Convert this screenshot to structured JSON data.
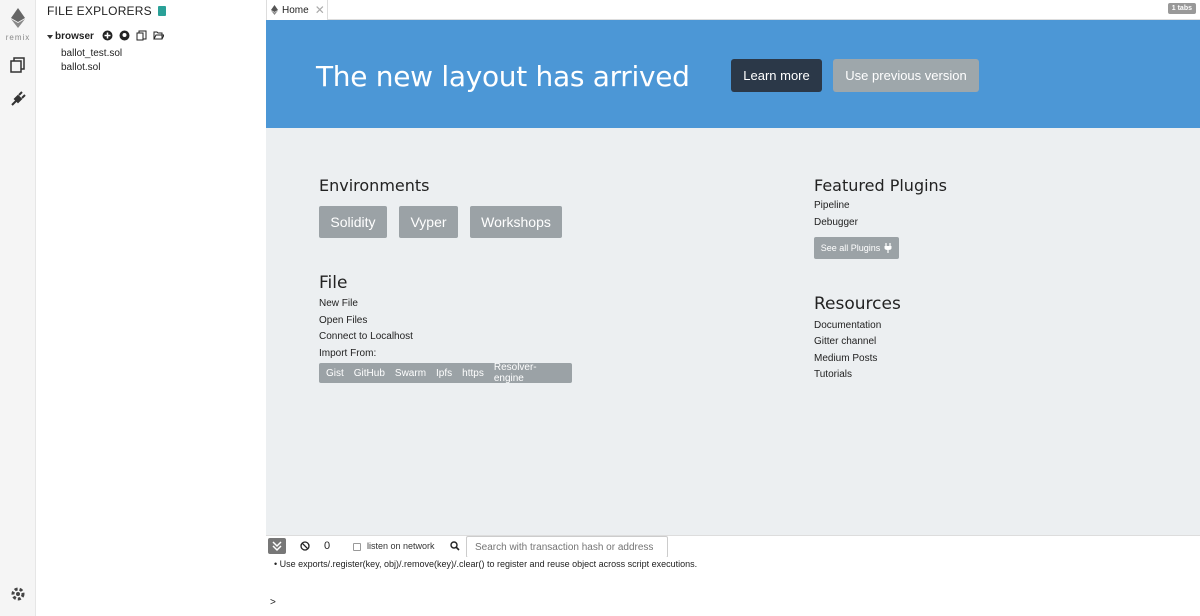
{
  "rail": {
    "logo_text": "remix",
    "icons": [
      "ethereum-icon",
      "file-explorer-icon",
      "plugin-manager-icon",
      "settings-icon"
    ]
  },
  "sidebar": {
    "title": "FILE EXPLORERS",
    "root": "browser",
    "files": [
      "ballot_test.sol",
      "ballot.sol"
    ]
  },
  "tabs": {
    "items": [
      {
        "label": "Home",
        "close": "✕"
      }
    ],
    "count_badge": "1 tabs"
  },
  "banner": {
    "headline": "The new layout has arrived",
    "learn_more": "Learn more",
    "previous_version": "Use previous version"
  },
  "environments": {
    "title": "Environments",
    "buttons": [
      "Solidity",
      "Vyper",
      "Workshops"
    ]
  },
  "file_section": {
    "title": "File",
    "links": [
      "New File",
      "Open Files",
      "Connect to Localhost"
    ],
    "import_label": "Import From:",
    "import_sources": [
      "Gist",
      "GitHub",
      "Swarm",
      "Ipfs",
      "https",
      "Resolver-engine"
    ]
  },
  "featured": {
    "title": "Featured Plugins",
    "links": [
      "Pipeline",
      "Debugger"
    ],
    "see_all": "See all Plugins"
  },
  "resources": {
    "title": "Resources",
    "links": [
      "Documentation",
      "Gitter channel",
      "Medium Posts",
      "Tutorials"
    ]
  },
  "terminal": {
    "count": "0",
    "listen_label": "listen on network",
    "search_placeholder": "Search with transaction hash or address",
    "log_line": "Use exports/.register(key, obj)/.remove(key)/.clear() to register and reuse object across script executions.",
    "prompt": ">"
  },
  "colors": {
    "banner": "#4c97d6",
    "dark_button": "#2b3848",
    "grey_button": "#9ba2a6",
    "main_bg": "#eceff1"
  }
}
